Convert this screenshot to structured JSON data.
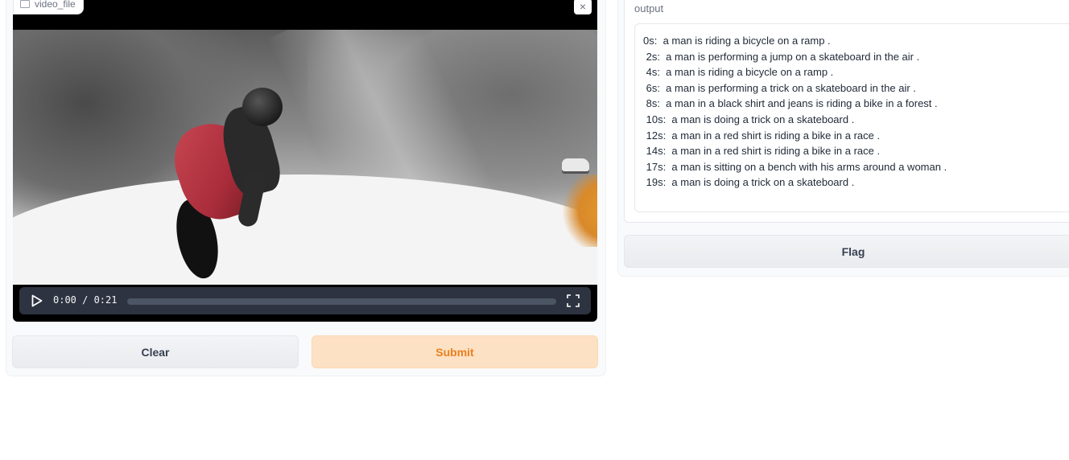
{
  "input": {
    "file_label": "video_file",
    "close_symbol": "×",
    "video": {
      "current_time": "0:00",
      "duration": "0:21",
      "time_display": "0:00 / 0:21",
      "progress_fraction": 0
    }
  },
  "actions": {
    "clear_label": "Clear",
    "submit_label": "Submit"
  },
  "output": {
    "label": "output",
    "lines": [
      "0s:  a man is riding a bicycle on a ramp .",
      " 2s:  a man is performing a jump on a skateboard in the air .",
      " 4s:  a man is riding a bicycle on a ramp .",
      " 6s:  a man is performing a trick on a skateboard in the air .",
      " 8s:  a man in a black shirt and jeans is riding a bike in a forest .",
      " 10s:  a man is doing a trick on a skateboard .",
      " 12s:  a man in a red shirt is riding a bike in a race .",
      " 14s:  a man in a red shirt is riding a bike in a race .",
      " 17s:  a man is sitting on a bench with his arms around a woman .",
      " 19s:  a man is doing a trick on a skateboard ."
    ]
  },
  "flag": {
    "label": "Flag"
  },
  "colors": {
    "submit_bg": "#fde1c4",
    "submit_text": "#ea7f1e",
    "controls_bg": "#2d3340"
  }
}
